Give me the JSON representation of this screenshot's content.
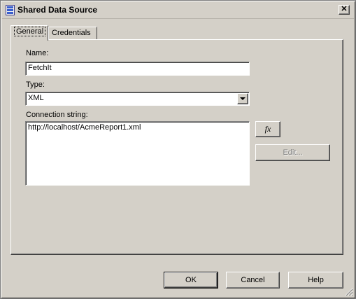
{
  "window": {
    "title": "Shared Data Source",
    "close_glyph": "✕"
  },
  "tabs": [
    {
      "label": "General",
      "active": true
    },
    {
      "label": "Credentials",
      "active": false
    }
  ],
  "general": {
    "name_label": "Name:",
    "name_value": "FetchIt",
    "type_label": "Type:",
    "type_value": "XML",
    "connection_label": "Connection string:",
    "connection_value": "http://localhost/AcmeReport1.xml",
    "expression_button_label": "fx",
    "edit_button_label": "Edit..."
  },
  "footer": {
    "ok_label": "OK",
    "cancel_label": "Cancel",
    "help_label": "Help"
  },
  "icons": {
    "app": "data-source-icon",
    "resize": "resize-grip-icon"
  }
}
